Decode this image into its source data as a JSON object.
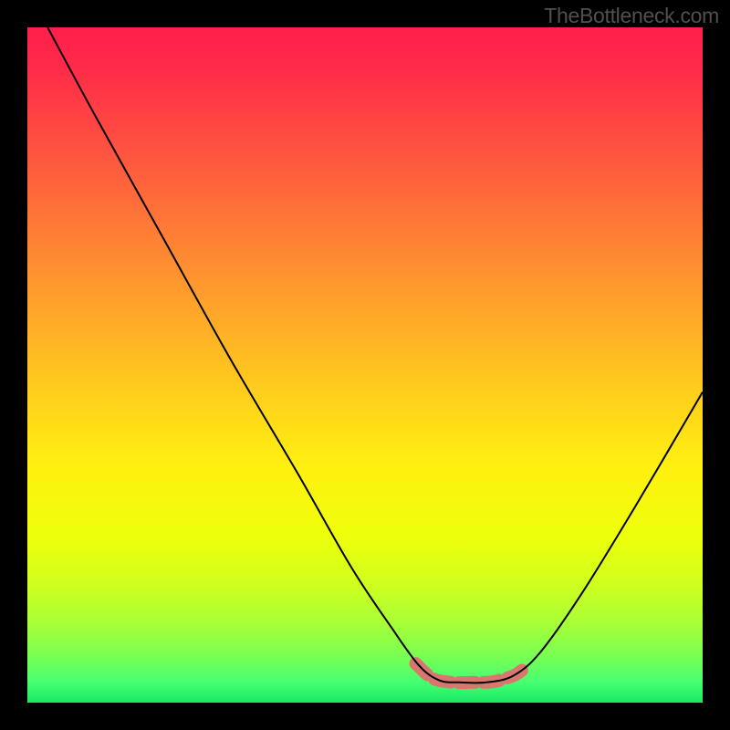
{
  "attribution": "TheBottleneck.com",
  "chart_data": {
    "type": "line",
    "title": "",
    "xlabel": "",
    "ylabel": "",
    "xlim": [
      0,
      100
    ],
    "ylim": [
      0,
      100
    ],
    "grid": false,
    "legend": false,
    "background": {
      "type": "vertical-gradient",
      "stops": [
        {
          "offset": 0.0,
          "color": "#ff1f4c"
        },
        {
          "offset": 0.06,
          "color": "#ff2b49"
        },
        {
          "offset": 0.15,
          "color": "#ff4842"
        },
        {
          "offset": 0.25,
          "color": "#ff6a3a"
        },
        {
          "offset": 0.35,
          "color": "#ff8d31"
        },
        {
          "offset": 0.45,
          "color": "#ffb026"
        },
        {
          "offset": 0.55,
          "color": "#ffd11b"
        },
        {
          "offset": 0.65,
          "color": "#fff010"
        },
        {
          "offset": 0.75,
          "color": "#efff0a"
        },
        {
          "offset": 0.82,
          "color": "#d2ff1c"
        },
        {
          "offset": 0.88,
          "color": "#aaff35"
        },
        {
          "offset": 0.93,
          "color": "#7aff52"
        },
        {
          "offset": 0.97,
          "color": "#46ff72"
        },
        {
          "offset": 1.0,
          "color": "#18e966"
        }
      ]
    },
    "series": [
      {
        "name": "bottleneck-curve",
        "color": "#000000",
        "stroke_width": 2,
        "x": [
          3.0,
          10.0,
          20.0,
          30.0,
          40.0,
          48.0,
          54.0,
          58.0,
          61.0,
          64.0,
          68.0,
          72.0,
          76.0,
          82.0,
          90.0,
          100.0
        ],
        "y": [
          100.0,
          87.0,
          69.0,
          51.0,
          34.0,
          20.0,
          11.0,
          5.5,
          3.3,
          3.0,
          3.0,
          4.0,
          7.5,
          16.0,
          29.0,
          46.0
        ]
      }
    ],
    "highlight_segment": {
      "name": "optimal-zone",
      "color": "#d9776f",
      "stroke_width": 14,
      "linecap": "round",
      "dash": [
        18,
        9
      ],
      "x": [
        57.5,
        60.0,
        63.0,
        66.0,
        69.0,
        72.0,
        73.5
      ],
      "y": [
        5.8,
        3.6,
        3.0,
        3.0,
        3.1,
        4.0,
        5.0
      ]
    }
  }
}
